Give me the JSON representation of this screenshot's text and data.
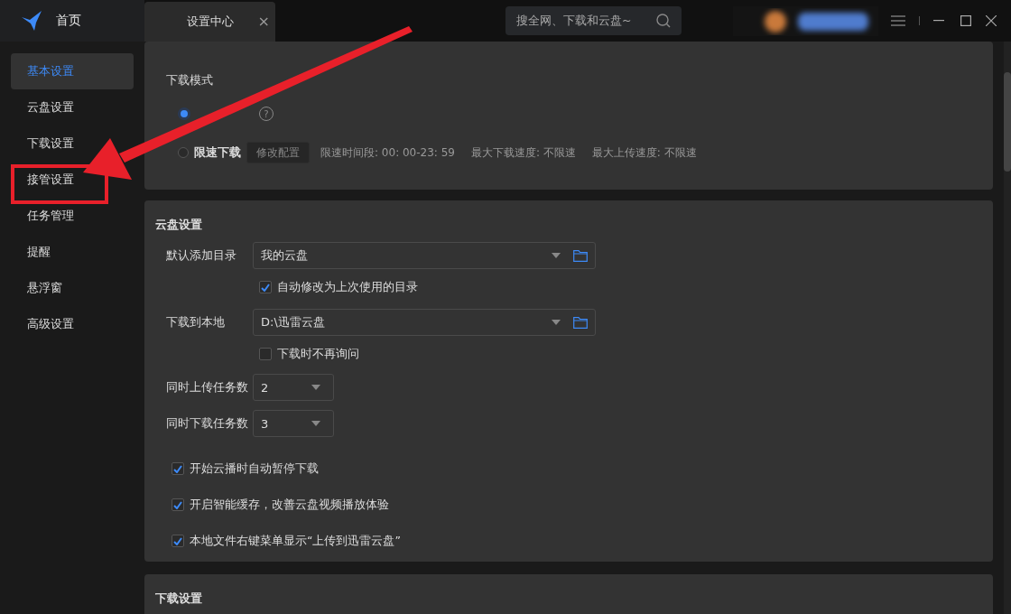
{
  "header": {
    "title": "首页"
  },
  "tabs": [
    {
      "label": "设置中心",
      "selected": true,
      "close": "×"
    }
  ],
  "search": {
    "placeholder": "搜全网、下载和云盘~"
  },
  "sidebar": {
    "items": [
      {
        "label": "基本设置",
        "selected": true
      },
      {
        "label": "云盘设置",
        "selected": false
      },
      {
        "label": "下载设置",
        "selected": false
      },
      {
        "label": "接管设置",
        "selected": false
      },
      {
        "label": "任务管理",
        "selected": false
      },
      {
        "label": "提醒",
        "selected": false
      },
      {
        "label": "悬浮窗",
        "selected": false
      },
      {
        "label": "高级设置",
        "selected": false
      }
    ]
  },
  "sections": [
    {
      "rows": [
        {
          "kind": "heading",
          "label": "下载模式"
        },
        {
          "kind": "radio",
          "selected": true,
          "help": "?"
        },
        {
          "kind": "radio",
          "label": "限速下载",
          "selected": false,
          "button": "修改配置",
          "notes": [
            "限速时间段:  00: 00-23: 59",
            "最大下载速度: 不限速",
            "最大上传速度: 不限速"
          ]
        }
      ]
    },
    {
      "title": "云盘设置",
      "rows": [
        {
          "kind": "dropdown",
          "label": "默认添加目录",
          "value": "我的云盘"
        },
        {
          "kind": "option",
          "label": "自动修改为上次使用的目录",
          "checked": true
        },
        {
          "kind": "dropdown",
          "label": "下载到本地",
          "value": "D:\\迅雷云盘"
        },
        {
          "kind": "option",
          "label": "下载时不再询问",
          "checked": false
        },
        {
          "kind": "count",
          "label": "同时上传任务数",
          "value": "2"
        },
        {
          "kind": "count",
          "label": "同时下载任务数",
          "value": "3"
        },
        {
          "kind": "checkbox",
          "label": "开始云播时自动暂停下载",
          "checked": true
        },
        {
          "kind": "checkbox",
          "label": "开启智能缓存，改善云盘视频播放体验",
          "checked": true
        },
        {
          "kind": "checkbox",
          "label": "本地文件右键菜单显示“上传到迅雷云盘”",
          "checked": true
        }
      ]
    },
    {
      "title": "下载设置"
    }
  ]
}
